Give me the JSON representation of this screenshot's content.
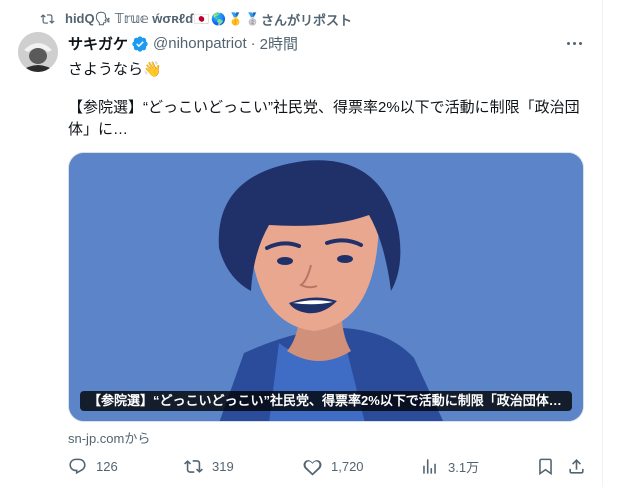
{
  "repost": {
    "name": "hidQ🗣 𝕋𝕣𝕦𝕖 ẃσʀℓɗ",
    "suffix": "さんがリポスト"
  },
  "post": {
    "display_name": "サキガケ",
    "handle": "@nihonpatriot",
    "separator": "·",
    "time": "2時間",
    "text_line": "さようなら",
    "text_emoji": "👋",
    "body": "【参院選】“どっこいどっこい”社民党、得票率2%以下で活動に制限「政治団体」に…"
  },
  "card": {
    "caption": "【参院選】“どっこいどっこい”社民党、得票率2%以下で活動に制限「政治団体…",
    "source": "sn-jp.comから"
  },
  "actions": {
    "replies": "126",
    "reposts": "319",
    "likes": "1,720",
    "views": "3.1万"
  },
  "colors": {
    "text": "#0f1419",
    "muted": "#536471",
    "verified": "#1d9bf0",
    "card_bg": "#5b84c9"
  },
  "icons": [
    "repost-icon",
    "verified-badge-icon",
    "more-icon",
    "reply-icon",
    "like-icon",
    "views-icon",
    "bookmark-icon",
    "share-icon"
  ]
}
